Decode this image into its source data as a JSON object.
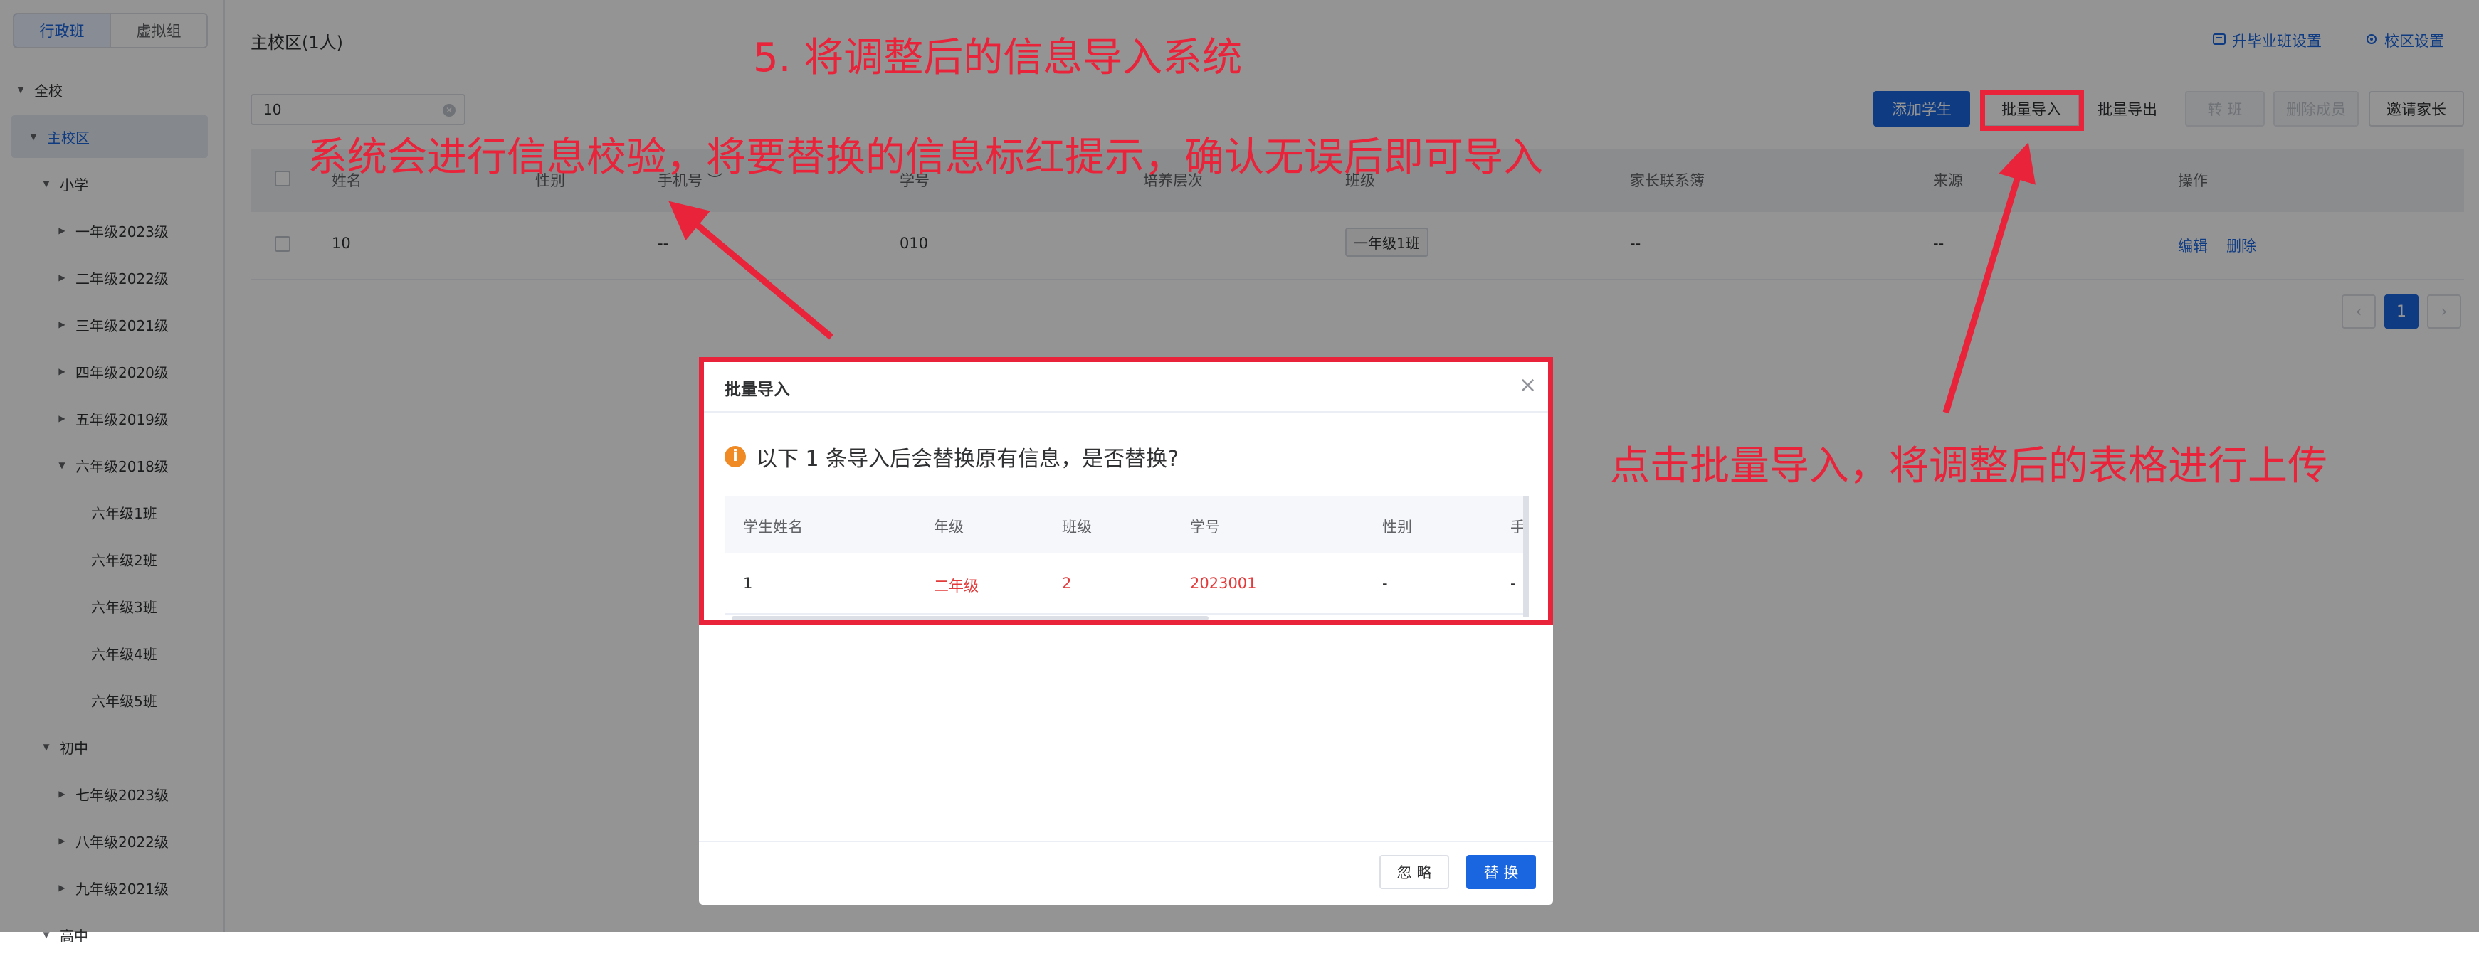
{
  "sidebar": {
    "tabs": [
      "行政班",
      "虚拟组"
    ],
    "tree": [
      {
        "label": "全校",
        "tri": "▼"
      },
      {
        "label": "主校区",
        "tri": "▼"
      },
      {
        "label": "小学",
        "tri": "▼"
      },
      {
        "label": "一年级2023级",
        "tri": "▶"
      },
      {
        "label": "二年级2022级",
        "tri": "▶"
      },
      {
        "label": "三年级2021级",
        "tri": "▶"
      },
      {
        "label": "四年级2020级",
        "tri": "▶"
      },
      {
        "label": "五年级2019级",
        "tri": "▶"
      },
      {
        "label": "六年级2018级",
        "tri": "▼"
      },
      {
        "label": "六年级1班",
        "tri": ""
      },
      {
        "label": "六年级2班",
        "tri": ""
      },
      {
        "label": "六年级3班",
        "tri": ""
      },
      {
        "label": "六年级4班",
        "tri": ""
      },
      {
        "label": "六年级5班",
        "tri": ""
      },
      {
        "label": "初中",
        "tri": "▼"
      },
      {
        "label": "七年级2023级",
        "tri": "▶"
      },
      {
        "label": "八年级2022级",
        "tri": "▶"
      },
      {
        "label": "九年级2021级",
        "tri": "▶"
      },
      {
        "label": "高中",
        "tri": "▼"
      }
    ]
  },
  "header": {
    "title": "主校区(1人)",
    "links": [
      "升毕业班设置",
      "校区设置"
    ]
  },
  "search": {
    "value": "10"
  },
  "toolbar": {
    "add": "添加学生",
    "import": "批量导入",
    "export": "批量导出",
    "transfer": "转 班",
    "delete_member": "删除成员",
    "invite": "邀请家长"
  },
  "table": {
    "headers": [
      "姓名",
      "性别",
      "手机号",
      "学号",
      "培养层次",
      "班级",
      "家长联系簿",
      "来源",
      "操作"
    ],
    "row": {
      "name": "10",
      "phone": "--",
      "student_no": "010",
      "class": "一年级1班",
      "contacts": "--",
      "source": "--",
      "edit": "编辑",
      "delete": "删除"
    }
  },
  "pagination": {
    "current": "1"
  },
  "dialog": {
    "title": "批量导入",
    "warning": "以下 1 条导入后会替换原有信息，是否替换?",
    "headers": [
      "学生姓名",
      "年级",
      "班级",
      "学号",
      "性别",
      "手"
    ],
    "row": [
      "1",
      "二年级",
      "2",
      "2023001",
      "-",
      "-"
    ],
    "ignore": "忽 略",
    "replace": "替 换"
  },
  "annotations": {
    "step": "5. 将调整后的信息导入系统",
    "validate": "系统会进行信息校验，将要替换的信息标红提示，确认无误后即可导入",
    "upload": "点击批量导入，将调整后的表格进行上传"
  },
  "colors": {
    "primary": "#1a66e0",
    "annotation": "#e8233a",
    "warning": "#f08a24",
    "replaced_value": "#e33b3b"
  }
}
